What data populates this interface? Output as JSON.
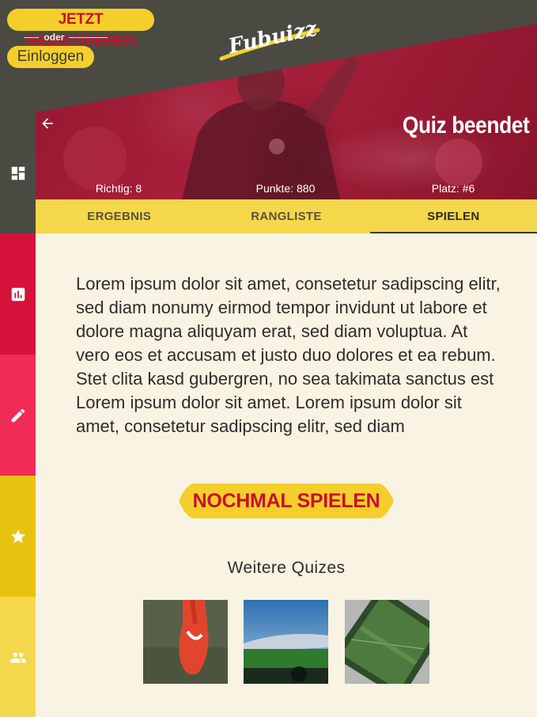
{
  "header": {
    "register_label": "JETZT REGISTRIEREN",
    "oder_label": "oder",
    "login_label": "Einloggen",
    "logo_text": "Fubuizz"
  },
  "result": {
    "title": "Quiz beendet",
    "stats": {
      "richtig": "Richtig: 8",
      "punkte": "Punkte: 880",
      "platz": "Platz: #6"
    }
  },
  "tabs": [
    {
      "label": "ERGEBNIS",
      "active": false
    },
    {
      "label": "RANGLISTE",
      "active": false
    },
    {
      "label": "SPIELEN",
      "active": true
    }
  ],
  "sidebar": {
    "items": [
      {
        "icon": "dashboard-icon",
        "color": "#4a4a43"
      },
      {
        "icon": "bar-chart-icon",
        "color": "#d4123a"
      },
      {
        "icon": "pencil-icon",
        "color": "#f02b56"
      },
      {
        "icon": "star-icon",
        "color": "#e8c210"
      },
      {
        "icon": "people-icon",
        "color": "#f4d74a"
      }
    ]
  },
  "main": {
    "body_text": "Lorem ipsum dolor sit amet, consetetur sadipscing elitr, sed diam nonumy eirmod tempor invidunt ut labore et dolore magna aliquyam erat, sed diam voluptua. At vero eos et accusam et justo duo dolores et ea rebum. Stet clita kasd gubergren, no sea takimata sanctus est Lorem ipsum dolor sit amet. Lorem ipsum dolor sit amet, consetetur sadipscing elitr, sed diam",
    "replay_label": "NOCHMAL SPIELEN",
    "more_title": "Weitere Quizes",
    "thumbnails": [
      {
        "subject": "football-boot"
      },
      {
        "subject": "stadium"
      },
      {
        "subject": "aerial-pitch"
      }
    ]
  },
  "colors": {
    "accent_yellow": "#f4cf2b",
    "brand_red": "#c8102e",
    "dark_header": "#4a4a43",
    "background": "#f8f3e2"
  }
}
